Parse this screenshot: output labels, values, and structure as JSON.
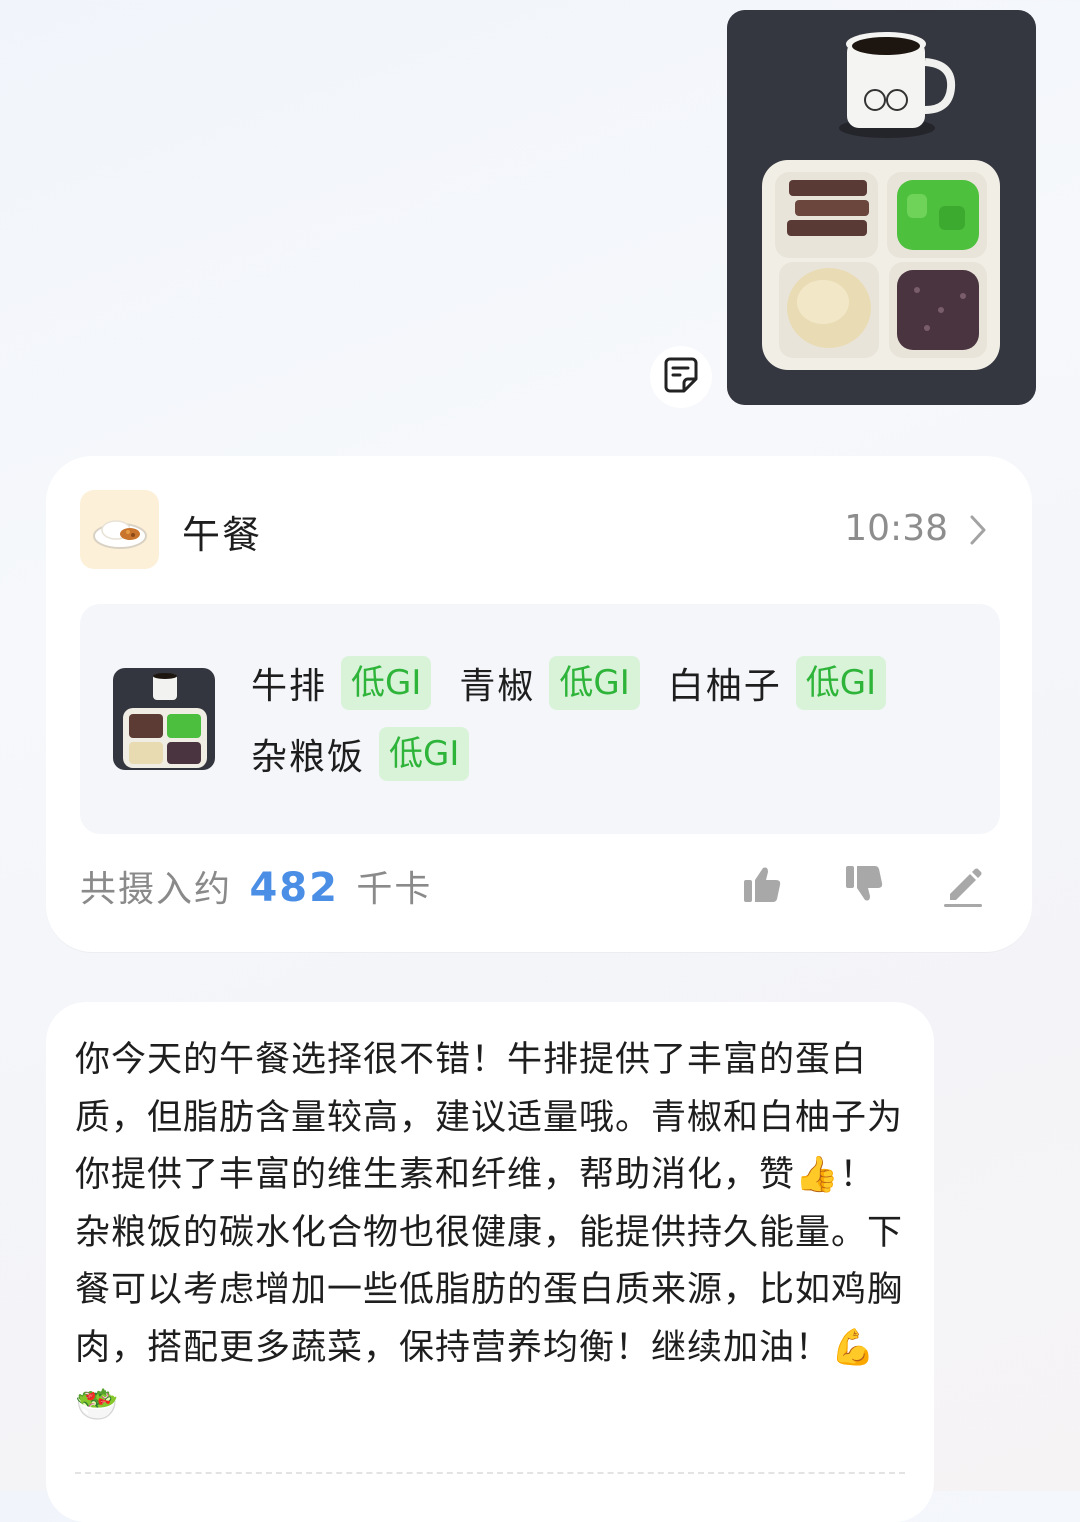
{
  "meal_card": {
    "title": "午餐",
    "time": "10:38",
    "foods": [
      {
        "name": "牛排",
        "tag": "低GI"
      },
      {
        "name": "青椒",
        "tag": "低GI"
      },
      {
        "name": "白柚子",
        "tag": "低GI"
      },
      {
        "name": "杂粮饭",
        "tag": "低GI"
      }
    ],
    "total_prefix": "共摄入约",
    "total_kcal": "482",
    "total_unit": "千卡"
  },
  "reply": {
    "text": "你今天的午餐选择很不错！牛排提供了丰富的蛋白质，但脂肪含量较高，建议适量哦。青椒和白柚子为你提供了丰富的维生素和纤维，帮助消化，赞👍！杂粮饭的碳水化合物也很健康，能提供持久能量。下餐可以考虑增加一些低脂肪的蛋白质来源，比如鸡胸肉，搭配更多蔬菜，保持营养均衡！继续加油！💪🥗"
  },
  "colors": {
    "gi_tag_bg": "#d9f3d9",
    "gi_tag_text": "#2fb43a",
    "kcal_accent": "#4a8ee6"
  },
  "icons": [
    "note-icon",
    "meal-plate-icon",
    "chevron-right-icon",
    "thumbs-up-icon",
    "thumbs-down-icon",
    "edit-pen-icon"
  ]
}
